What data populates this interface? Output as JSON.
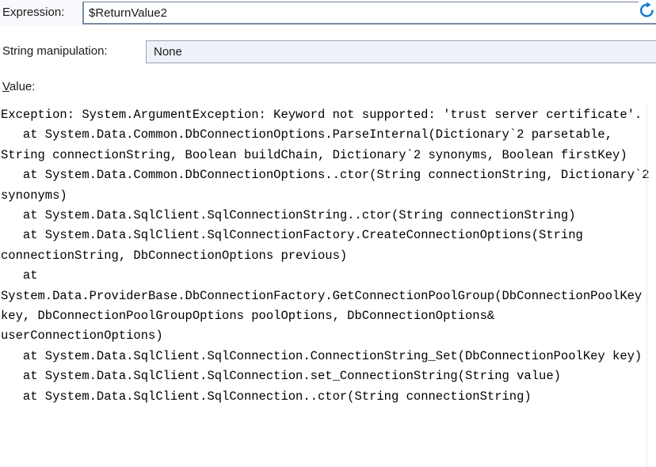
{
  "expression": {
    "label": "Expression:",
    "value": "$ReturnValue2",
    "placeholder": ""
  },
  "refresh": {
    "icon": "refresh-circular-arrow-icon",
    "color": "#0b7ad6",
    "tooltip": "Refresh"
  },
  "string_manipulation": {
    "label": "String manipulation:",
    "selected": "None",
    "options": [
      "None"
    ]
  },
  "value_section": {
    "label_accel": "V",
    "label_rest": "alue:",
    "text": "Exception: System.ArgumentException: Keyword not supported: 'trust server certificate'.\n   at System.Data.Common.DbConnectionOptions.ParseInternal(Dictionary`2 parsetable, String connectionString, Boolean buildChain, Dictionary`2 synonyms, Boolean firstKey)\n   at System.Data.Common.DbConnectionOptions..ctor(String connectionString, Dictionary`2 synonyms)\n   at System.Data.SqlClient.SqlConnectionString..ctor(String connectionString)\n   at System.Data.SqlClient.SqlConnectionFactory.CreateConnectionOptions(String connectionString, DbConnectionOptions previous)\n   at System.Data.ProviderBase.DbConnectionFactory.GetConnectionPoolGroup(DbConnectionPoolKey key, DbConnectionPoolGroupOptions poolOptions, DbConnectionOptions& userConnectionOptions)\n   at System.Data.SqlClient.SqlConnection.ConnectionString_Set(DbConnectionPoolKey key)\n   at System.Data.SqlClient.SqlConnection.set_ConnectionString(String value)\n   at System.Data.SqlClient.SqlConnection..ctor(String connectionString)"
  },
  "colors": {
    "band_background": "#f7f9fc",
    "input_border": "#7c8aa0",
    "select_background": "#eef1f8",
    "select_border": "#9aa3b2",
    "accent_blue": "#0b7ad6",
    "text": "#000000"
  }
}
